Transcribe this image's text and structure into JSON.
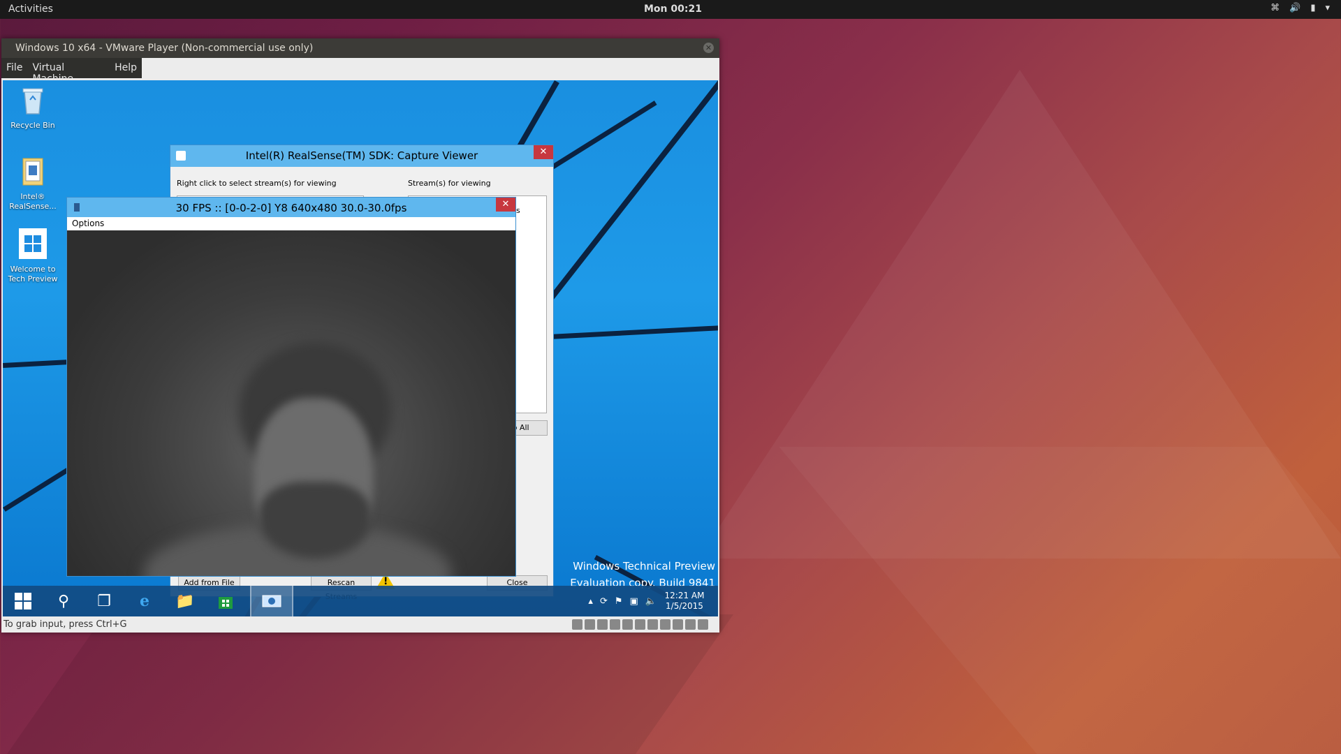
{
  "topbar": {
    "activities": "Activities",
    "clock": "Mon 00:21",
    "tray_icons": [
      "wifi-icon",
      "volume-icon",
      "battery-icon",
      "dropdown-arrow-icon"
    ]
  },
  "vmware": {
    "title": "Windows 10 x64 - VMware Player (Non-commercial use only)",
    "menu": {
      "file": "File",
      "virtual_machine": "Virtual Machine",
      "help": "Help"
    },
    "status_message": "To grab input, press Ctrl+G"
  },
  "desktop": {
    "icons": [
      {
        "label": "Recycle Bin"
      },
      {
        "label": "Intel® RealSense..."
      },
      {
        "label": "Welcome to Tech Preview"
      }
    ],
    "watermark": {
      "line1": "Windows Technical Preview",
      "line2": "Evaluation copy. Build 9841"
    }
  },
  "taskbar": {
    "clock_time": "12:21 AM",
    "clock_date": "1/5/2015"
  },
  "capture_viewer": {
    "title": "Intel(R) RealSense(TM) SDK: Capture Viewer",
    "left_label": "Right click to select stream(s) for viewing",
    "right_label": "Stream(s) for viewing",
    "partial_s": "s",
    "partial_stop_all": "p All",
    "add_from_file": "Add from File",
    "rescan_streams": "Rescan Streams",
    "close": "Close"
  },
  "stream_window": {
    "title": "30 FPS :: [0-0-2-0] Y8 640x480 30.0-30.0fps",
    "menu_options": "Options"
  }
}
